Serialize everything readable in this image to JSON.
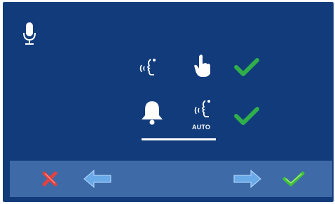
{
  "screen": {
    "mode_rows": [
      {
        "icons": [
          "speak-icon",
          "hand-press-icon"
        ],
        "status": "check-icon",
        "caption": ""
      },
      {
        "icons": [
          "bell-icon",
          "speak-icon"
        ],
        "status": "check-icon",
        "caption": "AUTO"
      }
    ],
    "selected_row": 2
  },
  "toolbar": {
    "buttons": [
      "cancel-icon",
      "back-arrow-icon",
      "forward-arrow-icon",
      "confirm-check-icon"
    ]
  },
  "colors": {
    "background": "#123b7c",
    "toolbar": "#3e6aa8",
    "check": "#2fae4a",
    "cancel": "#e2423f",
    "arrow": "#69a9e8"
  }
}
